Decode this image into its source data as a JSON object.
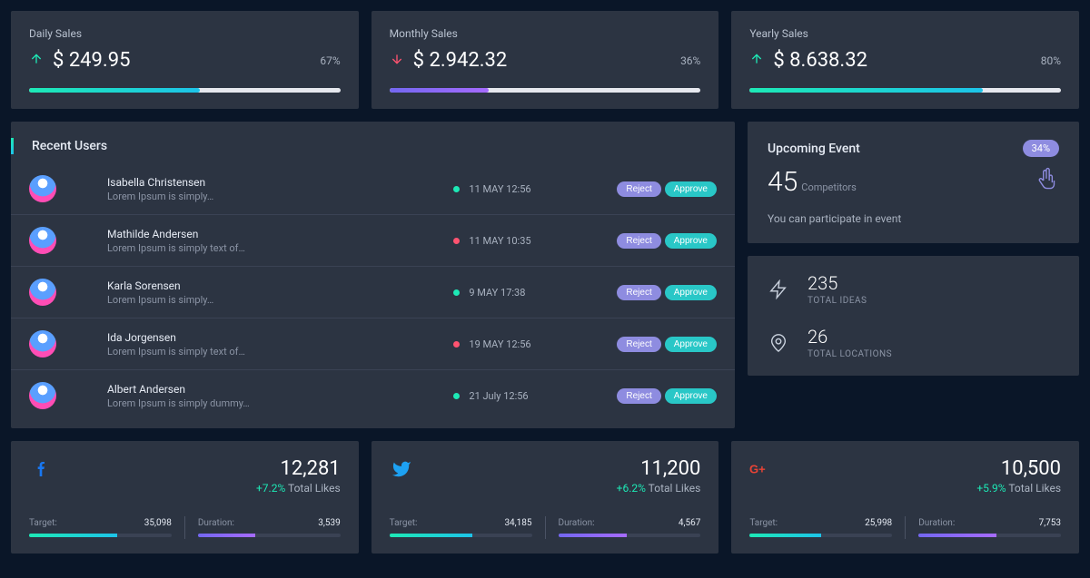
{
  "sales": [
    {
      "title": "Daily Sales",
      "amount": "$ 249.95",
      "pct": "67%",
      "dir": "up",
      "barPct": 55,
      "barClass": "grad-teal"
    },
    {
      "title": "Monthly Sales",
      "amount": "$ 2.942.32",
      "pct": "36%",
      "dir": "down",
      "barPct": 32,
      "barClass": "grad-purple"
    },
    {
      "title": "Yearly Sales",
      "amount": "$ 8.638.32",
      "pct": "80%",
      "dir": "up",
      "barPct": 75,
      "barClass": "grad-teal"
    }
  ],
  "recent": {
    "title": "Recent Users",
    "reject_label": "Reject",
    "approve_label": "Approve",
    "users": [
      {
        "name": "Isabella Christensen",
        "desc": "Lorem Ipsum is simply…",
        "time": "11 MAY 12:56",
        "status": "green"
      },
      {
        "name": "Mathilde Andersen",
        "desc": "Lorem Ipsum is simply text of…",
        "time": "11 MAY 10:35",
        "status": "red"
      },
      {
        "name": "Karla Sorensen",
        "desc": "Lorem Ipsum is simply…",
        "time": "9 MAY 17:38",
        "status": "green"
      },
      {
        "name": "Ida Jorgensen",
        "desc": "Lorem Ipsum is simply text of…",
        "time": "19 MAY 12:56",
        "status": "red"
      },
      {
        "name": "Albert Andersen",
        "desc": "Lorem Ipsum is simply dummy…",
        "time": "21 July 12:56",
        "status": "green"
      }
    ]
  },
  "event": {
    "title": "Upcoming Event",
    "badge": "34%",
    "count": "45",
    "label": "Competitors",
    "desc": "You can participate in event"
  },
  "stats": [
    {
      "icon": "zap",
      "value": "235",
      "label": "TOTAL IDEAS"
    },
    {
      "icon": "location",
      "value": "26",
      "label": "TOTAL LOCATIONS"
    }
  ],
  "social": [
    {
      "icon": "facebook",
      "color": "#1877f2",
      "count": "12,281",
      "growth": "+7.2%",
      "sub": " Total Likes",
      "target_k": "Target:",
      "target_v": "35,098",
      "target_pct": 62,
      "target_bar": "grad-teal",
      "duration_k": "Duration:",
      "duration_v": "3,539",
      "duration_pct": 40,
      "duration_bar": "grad-purple"
    },
    {
      "icon": "twitter",
      "color": "#1da1f2",
      "count": "11,200",
      "growth": "+6.2%",
      "sub": " Total Likes",
      "target_k": "Target:",
      "target_v": "34,185",
      "target_pct": 58,
      "target_bar": "grad-teal",
      "duration_k": "Duration:",
      "duration_v": "4,567",
      "duration_pct": 48,
      "duration_bar": "grad-purple"
    },
    {
      "icon": "google",
      "color": "#ea4335",
      "count": "10,500",
      "growth": "+5.9%",
      "sub": " Total Likes",
      "target_k": "Target:",
      "target_v": "25,998",
      "target_pct": 50,
      "target_bar": "grad-teal",
      "duration_k": "Duration:",
      "duration_v": "7,753",
      "duration_pct": 55,
      "duration_bar": "grad-purple"
    }
  ]
}
